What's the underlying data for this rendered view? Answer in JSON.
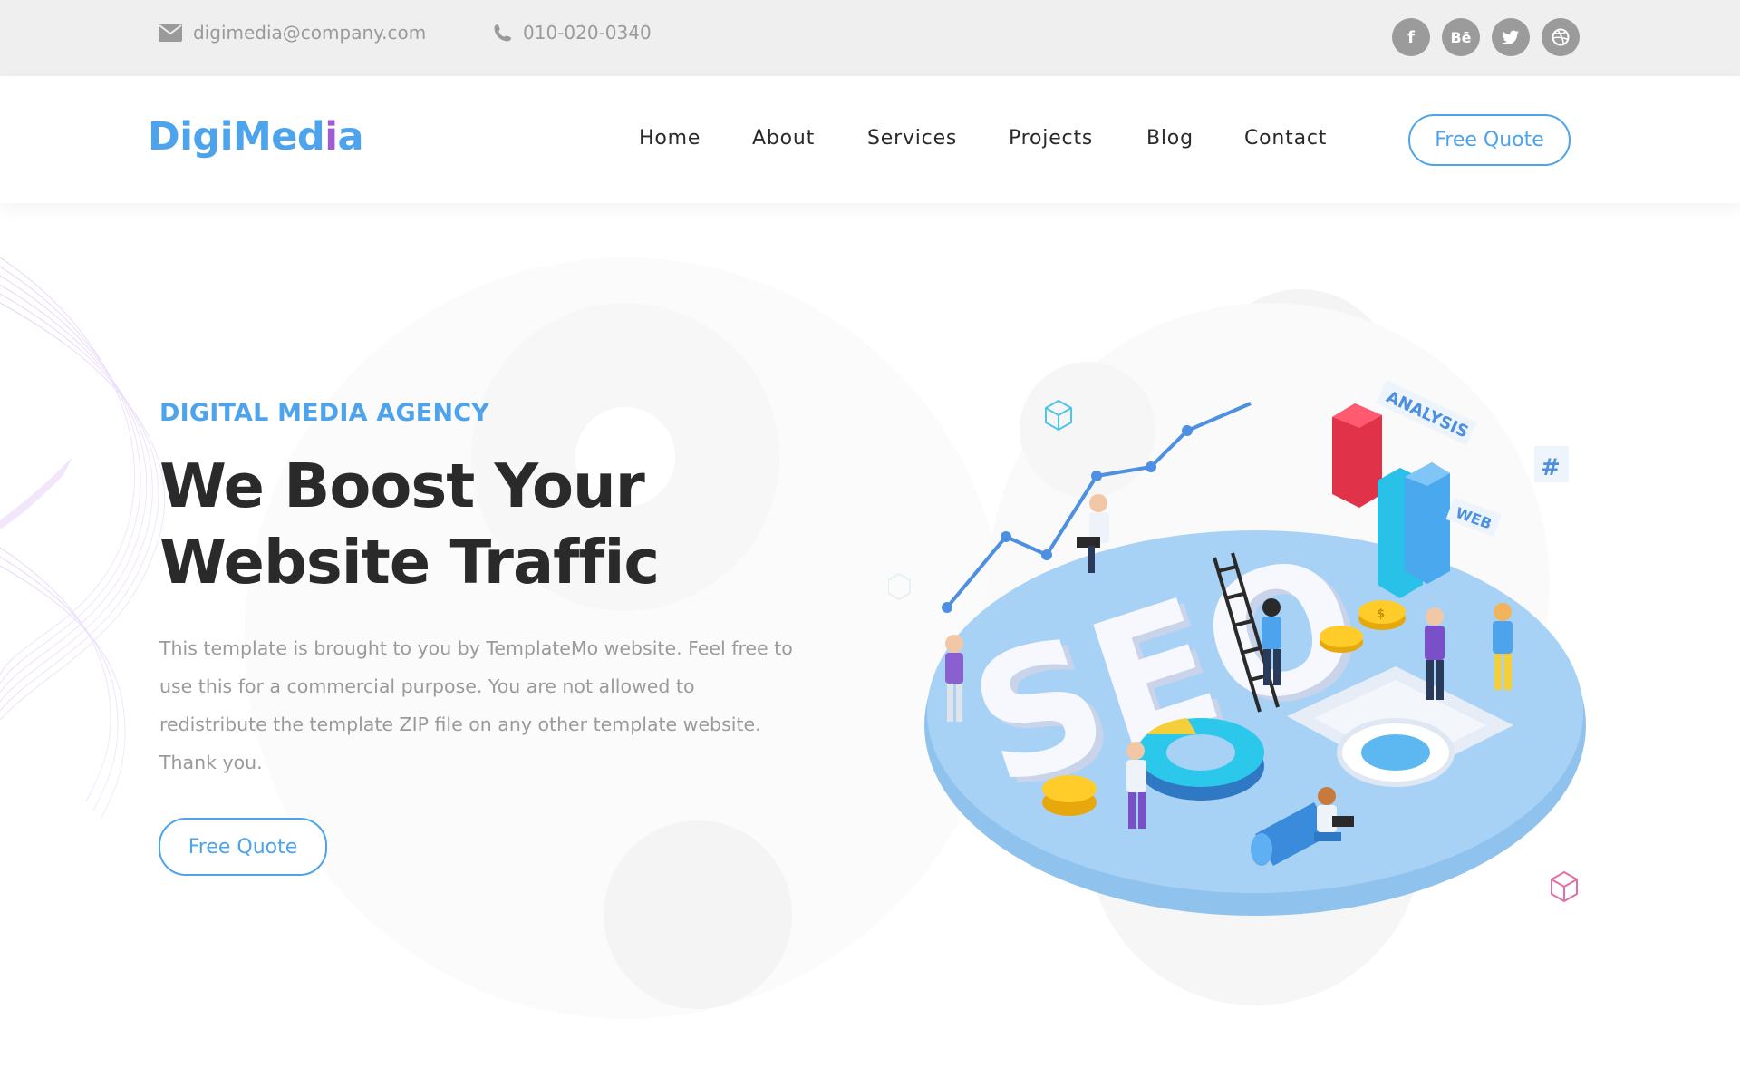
{
  "topbar": {
    "email": "digimedia@company.com",
    "phone": "010-020-0340",
    "social": [
      {
        "icon": "facebook-icon",
        "glyph": "f"
      },
      {
        "icon": "behance-icon",
        "glyph": "Bē"
      },
      {
        "icon": "twitter-icon",
        "glyph": ""
      },
      {
        "icon": "dribbble-icon",
        "glyph": ""
      }
    ]
  },
  "header": {
    "logo_main": "DigiMed",
    "logo_accent": "i",
    "logo_end": "a",
    "nav": [
      "Home",
      "About",
      "Services",
      "Projects",
      "Blog",
      "Contact"
    ],
    "cta": "Free Quote"
  },
  "hero": {
    "subtitle": "DIGITAL MEDIA AGENCY",
    "headline_line1": "We Boost Your",
    "headline_line2": "Website Traffic",
    "paragraph": "This template is brought to you by TemplateMo website. Feel free to use this for a commercial purpose. You are not allowed to redistribute the template ZIP file on any other template website. Thank you.",
    "cta": "Free Quote",
    "art_labels": {
      "seo": "SEO",
      "analysis": "ANALYSIS",
      "web": "WEB",
      "hash": "#",
      "coin": "$"
    }
  },
  "colors": {
    "accent_blue": "#4da3ec",
    "accent_purple": "#a05bd6",
    "topbar_bg": "#efefef",
    "text_dark": "#2a2a2a",
    "text_muted": "#9a9a9a"
  }
}
